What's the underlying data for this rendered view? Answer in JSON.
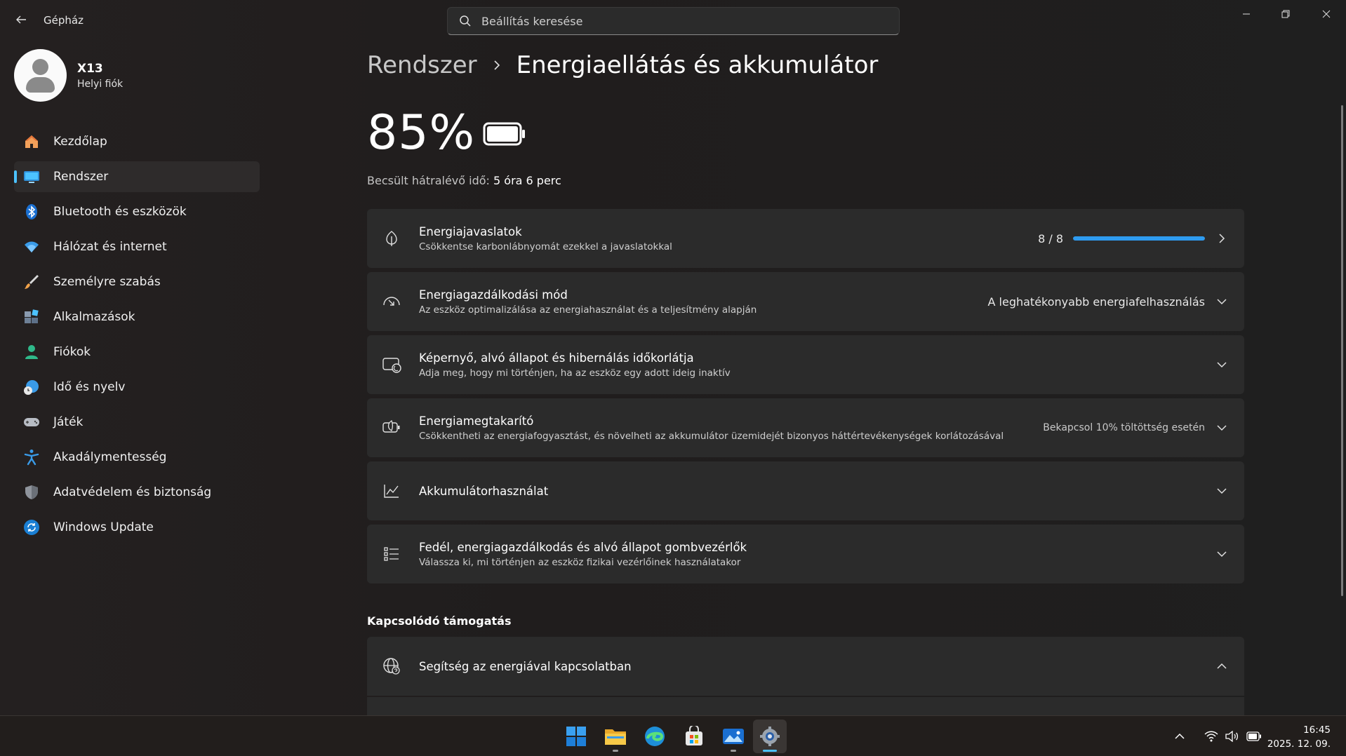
{
  "window": {
    "app_title": "Gépház",
    "search": {
      "placeholder": "Beállítás keresése",
      "value": ""
    }
  },
  "profile": {
    "name": "X13",
    "account_type": "Helyi fiók"
  },
  "sidebar": {
    "items": [
      {
        "label": "Kezdőlap",
        "icon": "home-icon",
        "active": false
      },
      {
        "label": "Rendszer",
        "icon": "system-monitor-icon",
        "active": true
      },
      {
        "label": "Bluetooth és eszközök",
        "icon": "bluetooth-icon",
        "active": false
      },
      {
        "label": "Hálózat és internet",
        "icon": "wifi-icon",
        "active": false
      },
      {
        "label": "Személyre szabás",
        "icon": "paintbrush-icon",
        "active": false
      },
      {
        "label": "Alkalmazások",
        "icon": "apps-icon",
        "active": false
      },
      {
        "label": "Fiókok",
        "icon": "account-icon",
        "active": false
      },
      {
        "label": "Idő és nyelv",
        "icon": "globe-clock-icon",
        "active": false
      },
      {
        "label": "Játék",
        "icon": "gamepad-icon",
        "active": false
      },
      {
        "label": "Akadálymentesség",
        "icon": "accessibility-icon",
        "active": false
      },
      {
        "label": "Adatvédelem és biztonság",
        "icon": "shield-icon",
        "active": false
      },
      {
        "label": "Windows Update",
        "icon": "update-icon",
        "active": false
      }
    ]
  },
  "header": {
    "parent": "Rendszer",
    "current": "Energiaellátás és akkumulátor"
  },
  "battery": {
    "percent_text": "85%",
    "level": 0.85,
    "remaining_label": "Becsült hátralévő idő:",
    "remaining_value": "5 óra 6 perc"
  },
  "cards": {
    "recommendations": {
      "title": "Energiajavaslatok",
      "subtitle": "Csökkentse karbonlábnyomát ezekkel a javaslatokkal",
      "value": "8 / 8",
      "progress": 1.0
    },
    "power_mode": {
      "title": "Energiagazdálkodási mód",
      "subtitle": "Az eszköz optimalizálása az energiahasználat és a teljesítmény alapján",
      "value": "A leghatékonyabb energiafelhasználás"
    },
    "screen_sleep": {
      "title": "Képernyő, alvó állapot és hibernálás időkorlátja",
      "subtitle": "Adja meg, hogy mi történjen, ha az eszköz egy adott ideig inaktív"
    },
    "energy_saver": {
      "title": "Energiamegtakarító",
      "subtitle": "Csökkentheti az energiafogyasztást, és növelheti az akkumulátor üzemidejét bizonyos háttértevékenységek korlátozásával",
      "value": "Bekapcsol 10% töltöttség esetén"
    },
    "battery_usage": {
      "title": "Akkumulátorhasználat"
    },
    "lid_buttons": {
      "title": "Fedél, energiagazdálkodás és alvó állapot gombvezérlők",
      "subtitle": "Válassza ki, mi történjen az eszköz fizikai vezérlőinek használatakor"
    }
  },
  "related": {
    "section_title": "Kapcsolódó támogatás",
    "help_title": "Segítség az energiával kapcsolatban"
  },
  "taskbar": {
    "apps": [
      "start-icon",
      "file-explorer-icon",
      "edge-icon",
      "store-icon",
      "photos-icon",
      "settings-icon"
    ],
    "clock_time": "16:45",
    "clock_date": "2025. 12. 09."
  },
  "colors": {
    "accent": "#4cc2ff",
    "progress": "#2e9bf0",
    "card_bg": "#2b2b2b",
    "window_bg": "#201d1d"
  }
}
